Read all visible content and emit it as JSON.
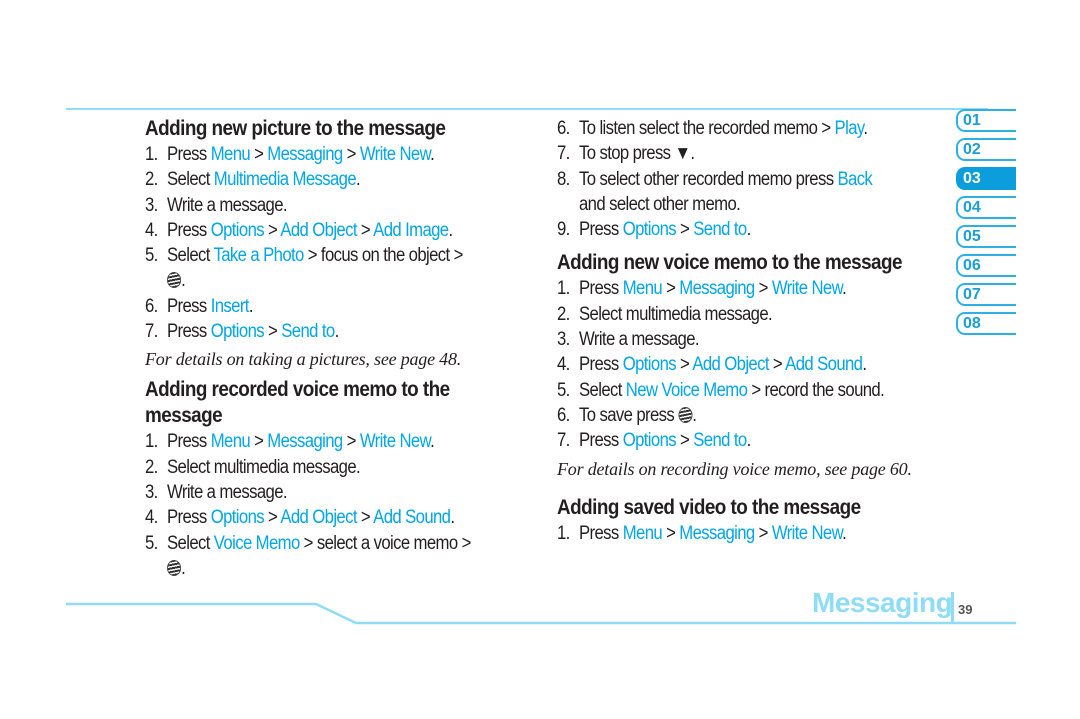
{
  "section_left": {
    "picture": {
      "heading": "Adding new picture to the message",
      "steps": [
        {
          "n": "1.",
          "parts": [
            "Press ",
            "Menu",
            " > ",
            "Messaging",
            " > ",
            "Write New",
            "."
          ]
        },
        {
          "n": "2.",
          "parts": [
            "Select ",
            "Multimedia Message",
            "."
          ]
        },
        {
          "n": "3.",
          "parts": [
            "Write a message."
          ]
        },
        {
          "n": "4.",
          "parts": [
            "Press ",
            "Options",
            " > ",
            "Add Object",
            " > ",
            "Add Image",
            "."
          ]
        },
        {
          "n": "5.",
          "parts": [
            "Select ",
            "Take a Photo",
            " > focus on the object >"
          ]
        },
        {
          "n": "6.",
          "parts": [
            "Press ",
            "Insert",
            "."
          ]
        },
        {
          "n": "7.",
          "parts": [
            "Press ",
            "Options",
            " > ",
            "Send to",
            "."
          ]
        }
      ],
      "note": "For details on taking a pictures, see page 48."
    },
    "recorded": {
      "heading": "Adding recorded voice memo to the message",
      "steps": [
        {
          "n": "1.",
          "parts": [
            "Press ",
            "Menu",
            " > ",
            "Messaging",
            " > ",
            "Write New",
            "."
          ]
        },
        {
          "n": "2.",
          "parts": [
            "Select multimedia message."
          ]
        },
        {
          "n": "3.",
          "parts": [
            "Write a message."
          ]
        },
        {
          "n": "4.",
          "parts": [
            "Press ",
            "Options",
            " > ",
            "Add Object",
            " > ",
            "Add Sound",
            "."
          ]
        },
        {
          "n": "5.",
          "parts": [
            "Select ",
            "Voice Memo",
            " > select a voice memo >"
          ]
        }
      ]
    }
  },
  "section_right": {
    "recorded_cont": {
      "steps": [
        {
          "n": "6.",
          "parts": [
            "To listen select the recorded memo > ",
            "Play",
            "."
          ]
        },
        {
          "n": "7.",
          "parts": [
            "To stop press ▼."
          ]
        },
        {
          "n": "8.",
          "parts": [
            "To select other recorded memo press ",
            "Back"
          ],
          "cont": "and select other memo."
        },
        {
          "n": "9.",
          "parts": [
            "Press ",
            "Options",
            " > ",
            "Send to",
            "."
          ]
        }
      ]
    },
    "new_voice": {
      "heading": "Adding new voice memo to the message",
      "steps": [
        {
          "n": "1.",
          "parts": [
            "Press ",
            "Menu",
            " > ",
            "Messaging",
            " > ",
            "Write New",
            "."
          ]
        },
        {
          "n": "2.",
          "parts": [
            "Select multimedia message."
          ]
        },
        {
          "n": "3.",
          "parts": [
            "Write a message."
          ]
        },
        {
          "n": "4.",
          "parts": [
            "Press ",
            "Options",
            " > ",
            "Add Object",
            " > ",
            "Add Sound",
            "."
          ]
        },
        {
          "n": "5.",
          "parts": [
            "Select ",
            "New Voice Memo",
            " > record the sound."
          ]
        },
        {
          "n": "6.",
          "parts": [
            "To save press "
          ]
        },
        {
          "n": "7.",
          "parts": [
            "Press ",
            "Options",
            " > ",
            "Send to",
            "."
          ]
        }
      ],
      "note": "For details on recording voice memo, see page 60."
    },
    "video": {
      "heading": "Adding saved video to the message",
      "steps": [
        {
          "n": "1.",
          "parts": [
            "Press ",
            "Menu",
            " > ",
            "Messaging",
            " > ",
            "Write New",
            "."
          ]
        }
      ]
    }
  },
  "chapter_tabs": [
    "01",
    "02",
    "03",
    "04",
    "05",
    "06",
    "07",
    "08"
  ],
  "active_tab": "03",
  "footer": {
    "title": "Messaging",
    "page": "39"
  },
  "colors": {
    "accent": "#00a6e6",
    "rule": "#8fdcf6",
    "tab_active": "#0b9ddc"
  },
  "icons": {
    "ok_key": "att-globe-icon"
  }
}
